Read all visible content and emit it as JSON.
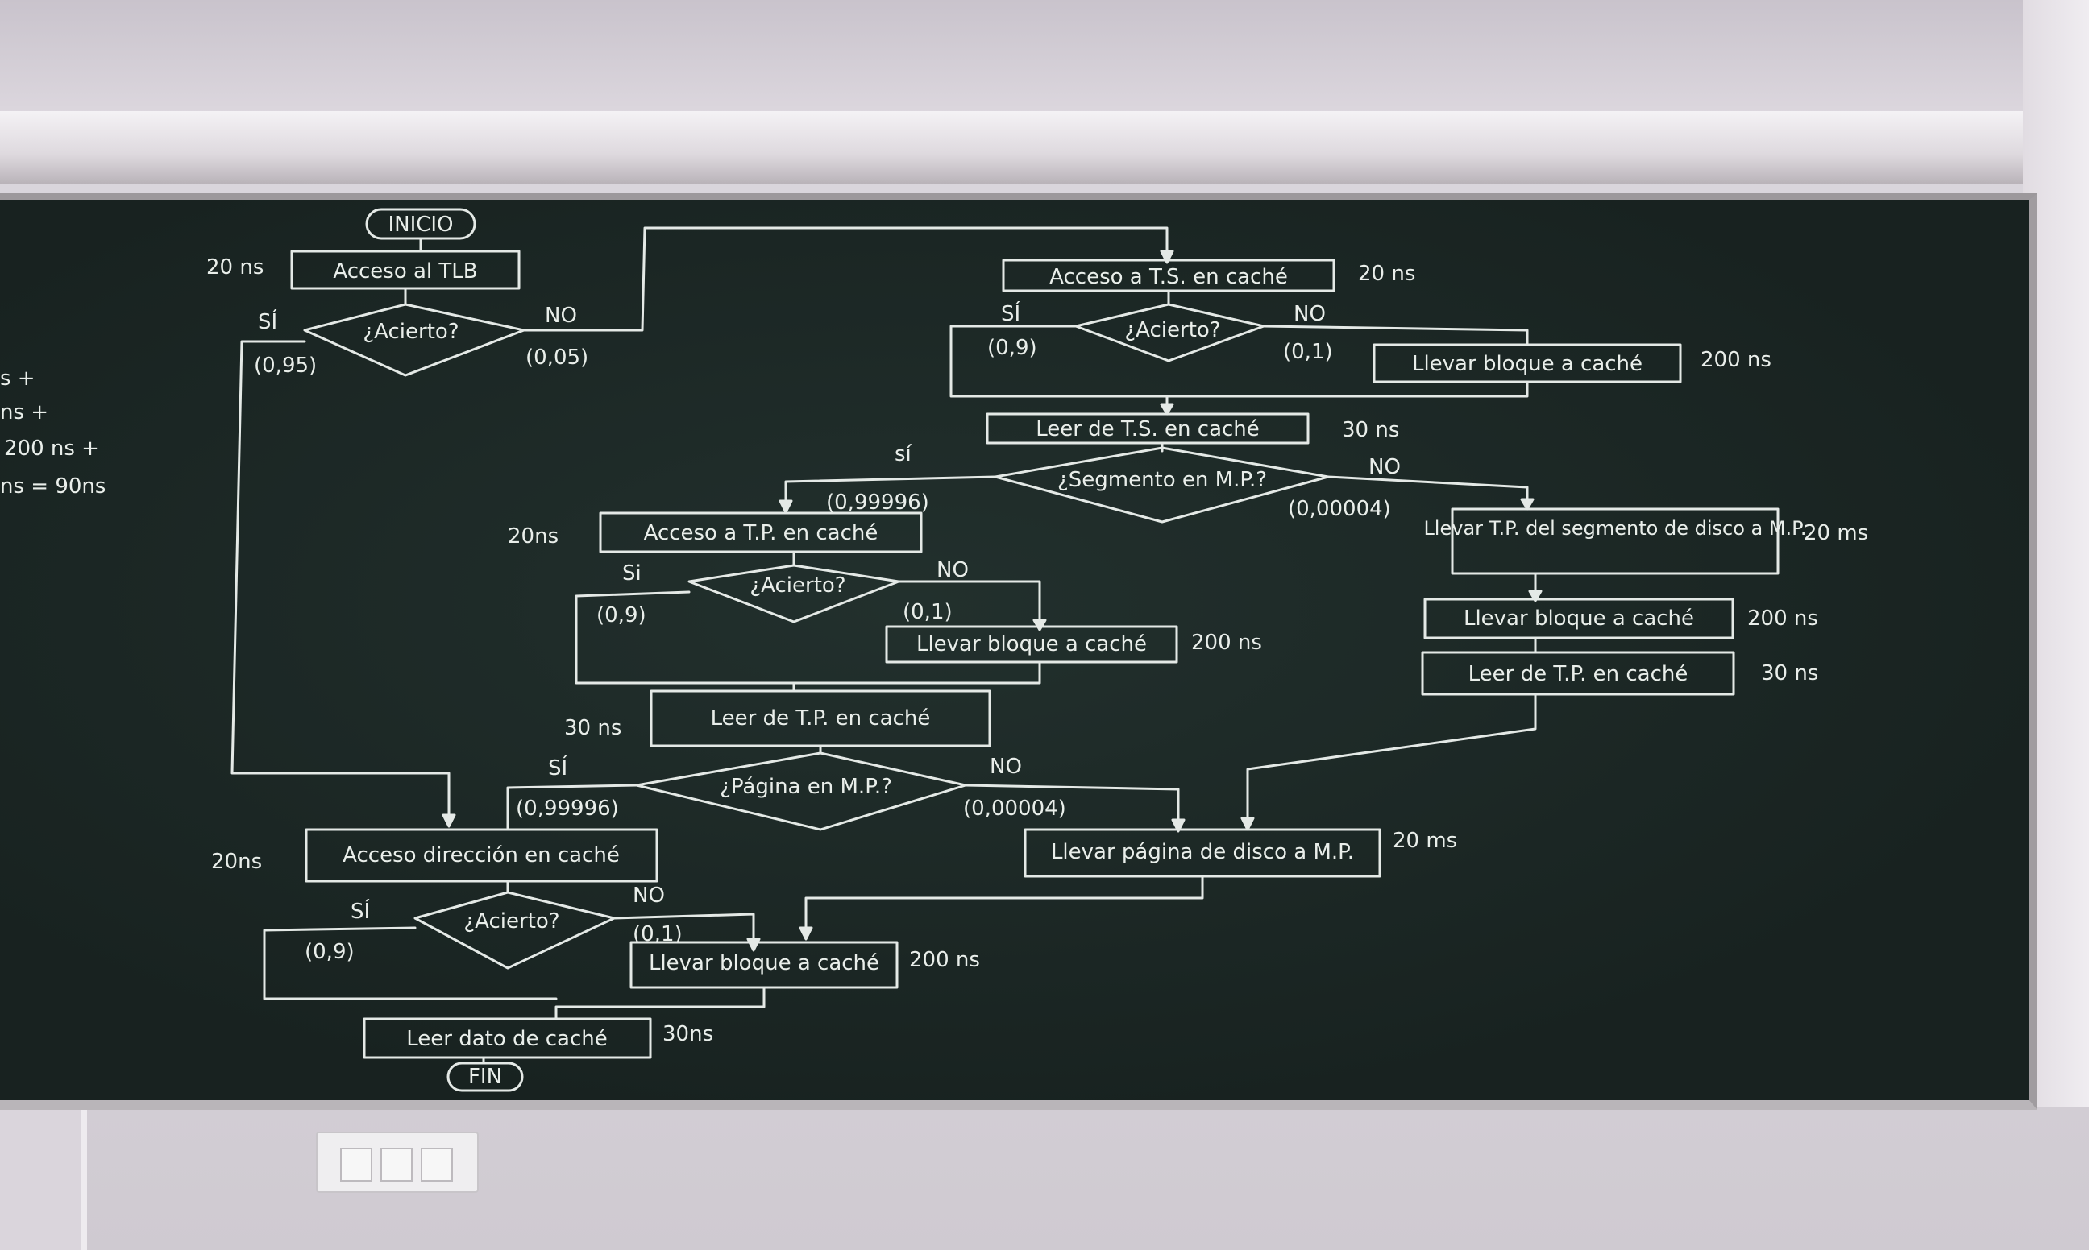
{
  "left_partial": [
    "s +",
    "ns +",
    "200 ns +",
    "ns = 90ns"
  ],
  "start": "INICIO",
  "end": "FIN",
  "labels": {
    "si": "SÍ",
    "no": "NO",
    "si2": "sí",
    "si3": "Si"
  },
  "col1": {
    "t_tlb": "20 ns",
    "tlb": "Acceso al TLB",
    "tlb_q": "¿Acierto?",
    "p_si": "(0,95)",
    "p_no": "(0,05)"
  },
  "col2": {
    "acc_ts": "Acceso a T.S. en caché",
    "t_acc_ts": "20 ns",
    "q1": "¿Acierto?",
    "p1_si": "(0,9)",
    "p1_no": "(0,1)",
    "llevar": "Llevar bloque a caché",
    "t_llevar": "200 ns",
    "leer_ts": "Leer de T.S. en caché",
    "t_leer_ts": "30 ns",
    "q_seg": "¿Segmento en M.P.?",
    "p_seg_si": "(0,99996)",
    "p_seg_no": "(0,00004)",
    "acc_tp": "Acceso a T.P. en caché",
    "t_acc_tp": "20ns",
    "q2": "¿Acierto?",
    "p2_si": "(0,9)",
    "p2_no": "(0,1)",
    "llevar2": "Llevar bloque a caché",
    "t_llevar2": "200 ns",
    "leer_tp": "Leer de T.P. en caché",
    "t_leer_tp": "30 ns",
    "llevar_tp": "Llevar T.P. del segmento de disco a M.P.",
    "t_llevar_tp": "20 ms",
    "llevar3": "Llevar bloque a caché",
    "t_llevar3": "200 ns",
    "leer_tp2": "Leer de T.P. en caché",
    "t_leer_tp2": "30 ns"
  },
  "bottom": {
    "q_pag": "¿Página en M.P.?",
    "p_pag_si": "(0,99996)",
    "p_pag_no": "(0,00004)",
    "llevar_pag": "Llevar página de disco a M.P.",
    "t_llevar_pag": "20 ms",
    "acc_dir": "Acceso dirección en caché",
    "t_acc_dir": "20ns",
    "q3": "¿Acierto?",
    "p3_si": "(0,9)",
    "p3_no": "(0,1)",
    "llevar4": "Llevar bloque a caché",
    "t_llevar4": "200 ns",
    "leer_dato": "Leer dato de caché",
    "t_leer_dato": "30ns"
  }
}
